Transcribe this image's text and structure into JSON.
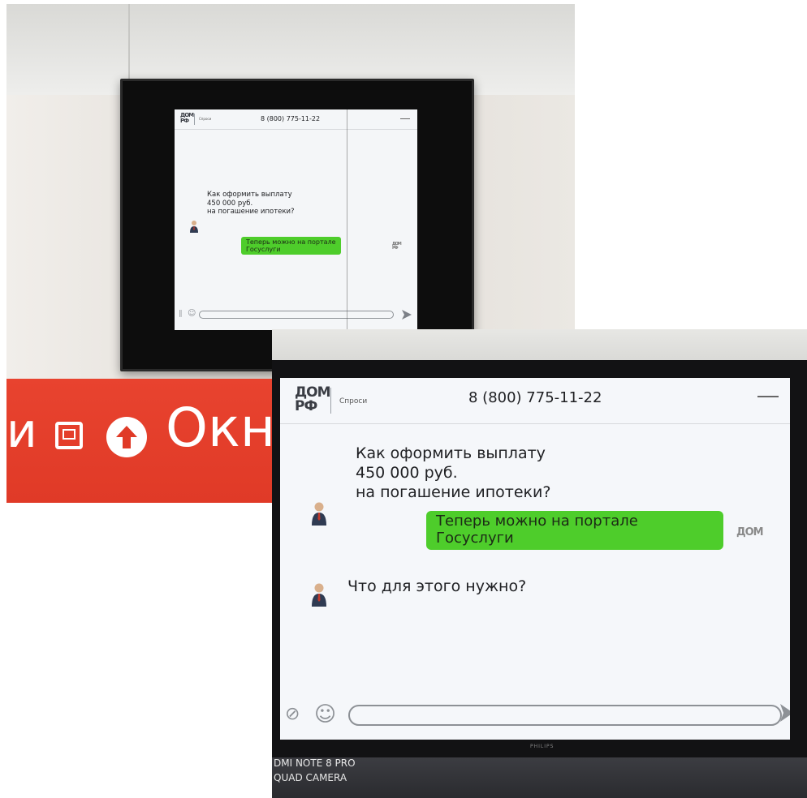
{
  "photos": [
    {
      "name": "Photo of kiosk screen with chat (earlier)",
      "chat": {
        "logo": {
          "line1": "ДОМ",
          "line2": "РФ"
        },
        "brand": "Спроси",
        "phone": "8 (800) 775-11-22",
        "messages": [
          {
            "from": "user",
            "text": "Как оформить выплату\n450 000 руб.\nна погашение ипотеки?"
          },
          {
            "from": "bot",
            "text": "Теперь можно на портале\nГосуслуги"
          }
        ]
      },
      "sign": {
        "text_left": "и",
        "text_right": "Окн"
      }
    },
    {
      "name": "Photo of kiosk screen with chat (later)",
      "chat": {
        "logo": {
          "line1": "ДОМ",
          "line2": "РФ"
        },
        "brand": "Спроси",
        "phone": "8 (800) 775-11-22",
        "messages": [
          {
            "from": "user",
            "text": "Как оформить выплату\n450 000 руб.\nна погашение ипотеки?"
          },
          {
            "from": "bot",
            "text": "Теперь можно на портале\nГосуслуги"
          },
          {
            "from": "user",
            "text": "Что для этого нужно?"
          }
        ],
        "bot_logo_text": "ДОМ"
      },
      "tv_brand": "PHILIPS",
      "watermark": {
        "line1": "DMI NOTE 8 PRO",
        "line2": "QUAD CAMERA"
      }
    }
  ],
  "colors": {
    "sign_red": "#e03a27",
    "bot_bubble": "#4ecd2b",
    "screen_bg": "#f5f7fa"
  }
}
